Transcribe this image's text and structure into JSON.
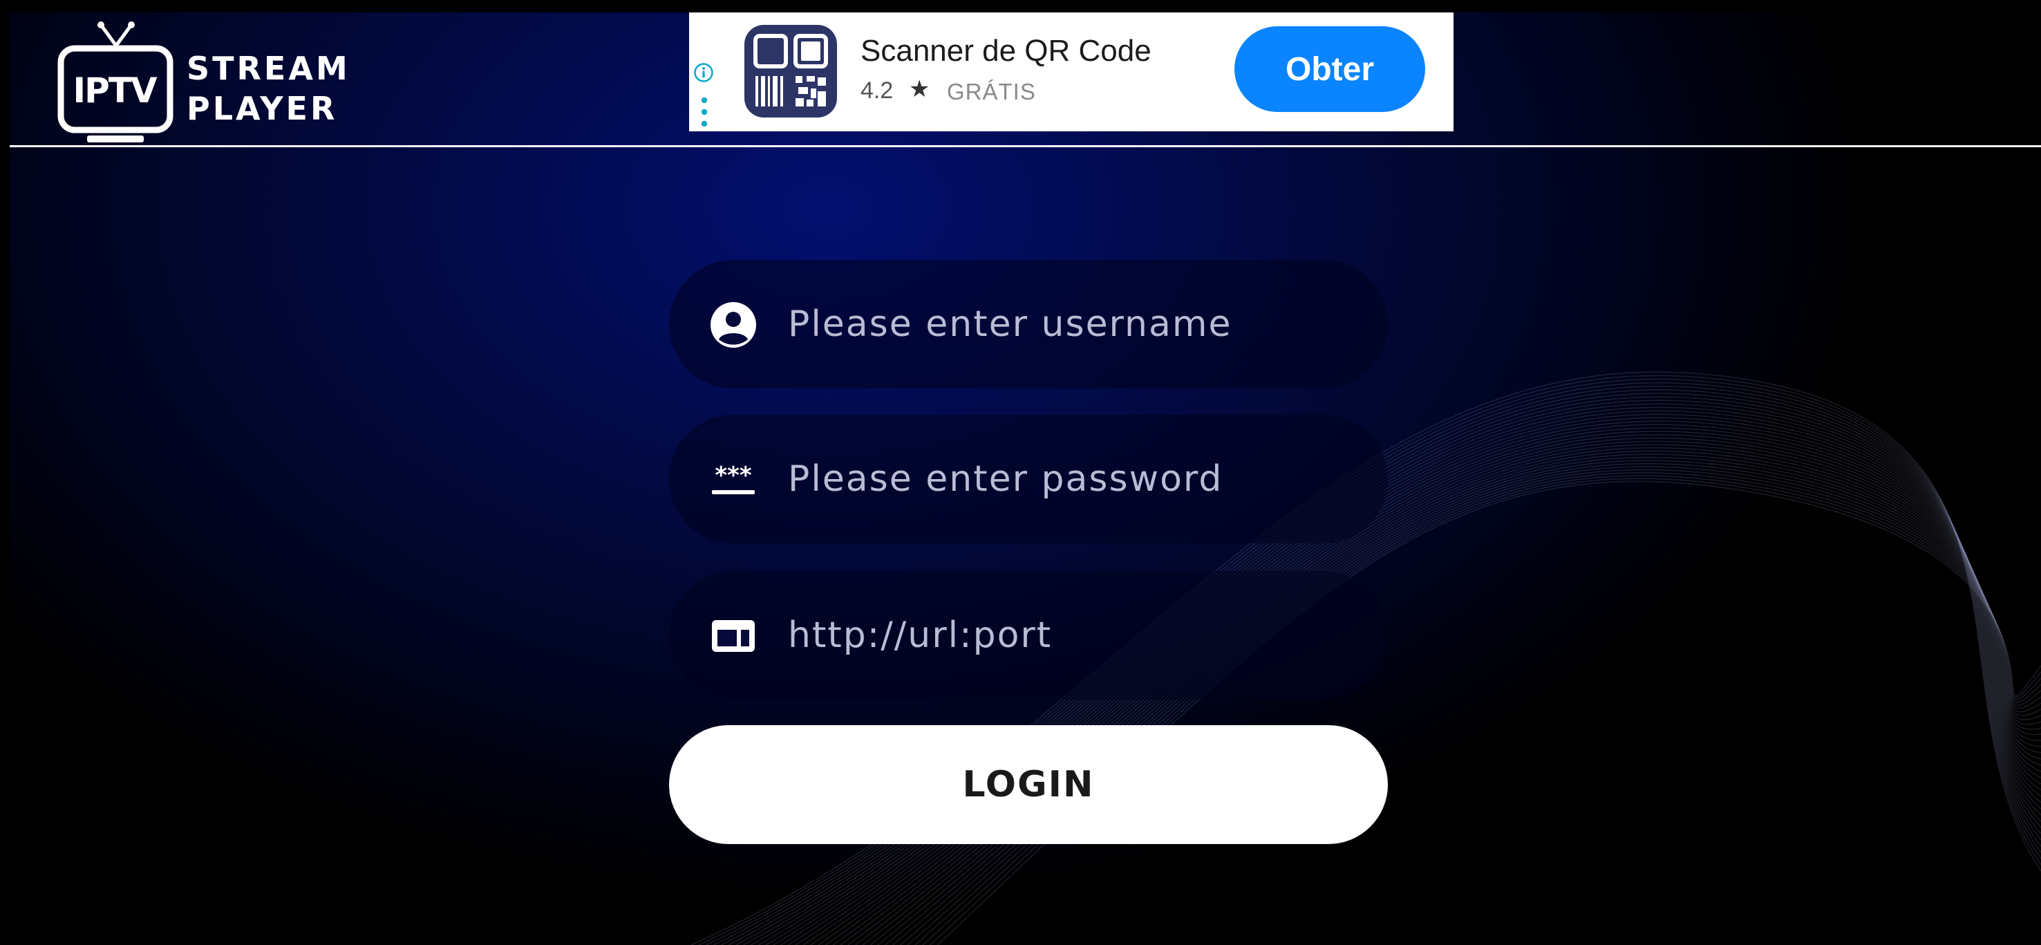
{
  "app": {
    "logo_badge": "IPTV",
    "logo_word_1": "STREAM",
    "logo_word_2": "PLAYER"
  },
  "ad": {
    "app_name": "Scanner de QR Code",
    "rating": "4.2",
    "star_glyph": "★",
    "price": "GRÁTIS",
    "button_label": "Obter",
    "icons": {
      "info": "info-icon",
      "menu": "kebab-menu-icon",
      "app": "qr-code-app-icon"
    }
  },
  "login_form": {
    "username": {
      "placeholder": "Please enter username",
      "value": "",
      "icon": "user-icon"
    },
    "password": {
      "placeholder": "Please enter password",
      "value": "",
      "icon": "password-icon"
    },
    "url": {
      "placeholder": "http://url:port",
      "value": "",
      "icon": "server-url-icon"
    },
    "login_label": "LOGIN"
  },
  "colors": {
    "background_deep": "#000000",
    "background_glow": "#031070",
    "ad_button": "#0a84ff",
    "login_button": "#ffffff",
    "placeholder_text": "#b9bcd4"
  }
}
